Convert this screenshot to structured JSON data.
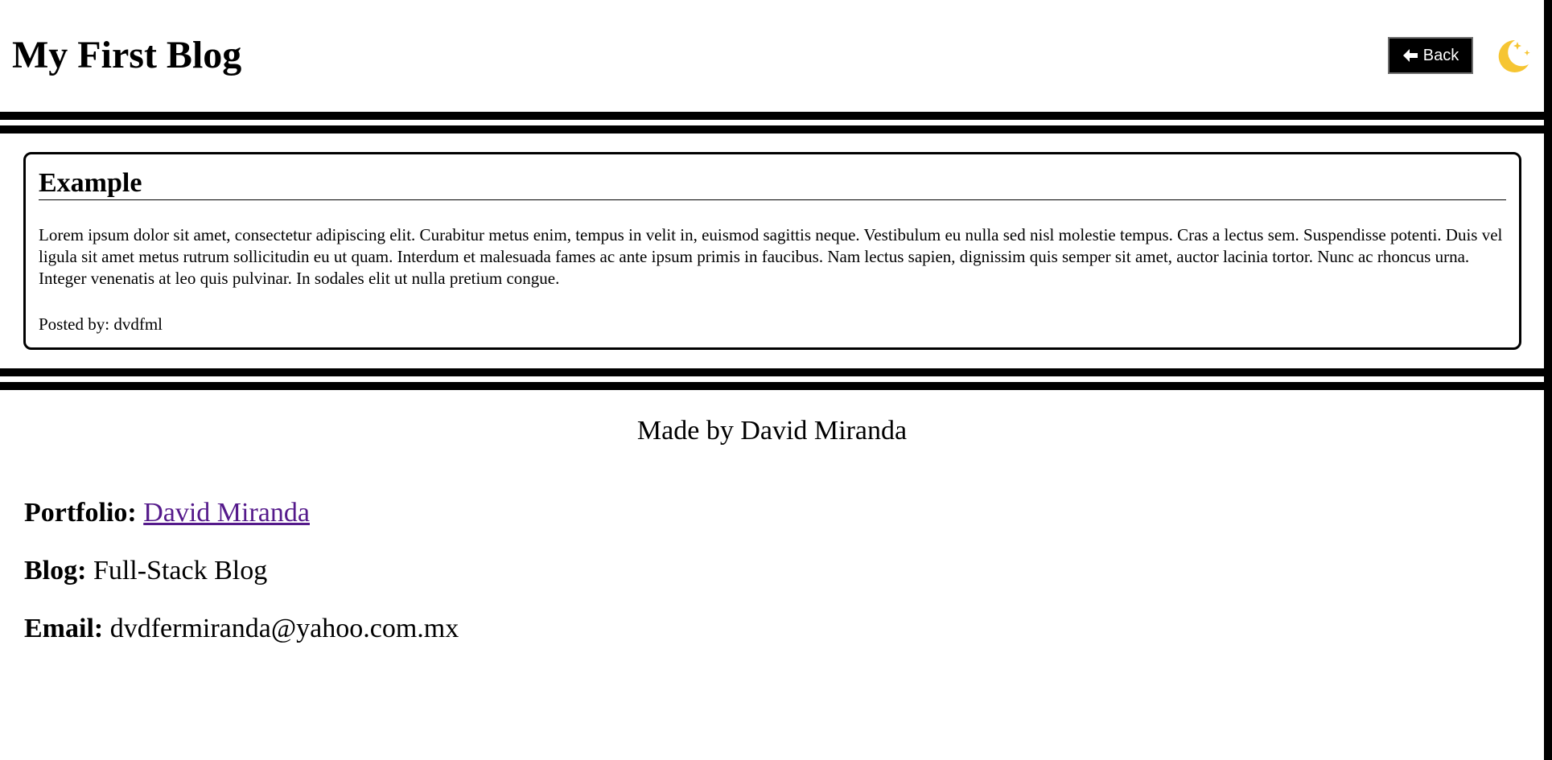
{
  "header": {
    "title": "My First Blog",
    "back_label": "Back",
    "back_icon": "arrow-left-icon",
    "theme_icon": "moon-stars-icon",
    "theme_color": "#f6c532"
  },
  "post": {
    "title": "Example",
    "body": "Lorem ipsum dolor sit amet, consectetur adipiscing elit. Curabitur metus enim, tempus in velit in, euismod sagittis neque. Vestibulum eu nulla sed nisl molestie tempus. Cras a lectus sem. Suspendisse potenti. Duis vel ligula sit amet metus rutrum sollicitudin eu ut quam. Interdum et malesuada fames ac ante ipsum primis in faucibus. Nam lectus sapien, dignissim quis semper sit amet, auctor lacinia tortor. Nunc ac rhoncus urna. Integer venenatis at leo quis pulvinar. In sodales elit ut nulla pretium congue.",
    "author": "Posted by: dvdfml"
  },
  "footer": {
    "credit": "Made by David Miranda",
    "portfolio_label": "Portfolio:",
    "portfolio_link": "David Miranda",
    "blog_label": "Blog:",
    "blog_value": "Full-Stack Blog",
    "email_label": "Email:",
    "email_value": "dvdfermiranda@yahoo.com.mx",
    "link_color": "#551a8b"
  }
}
